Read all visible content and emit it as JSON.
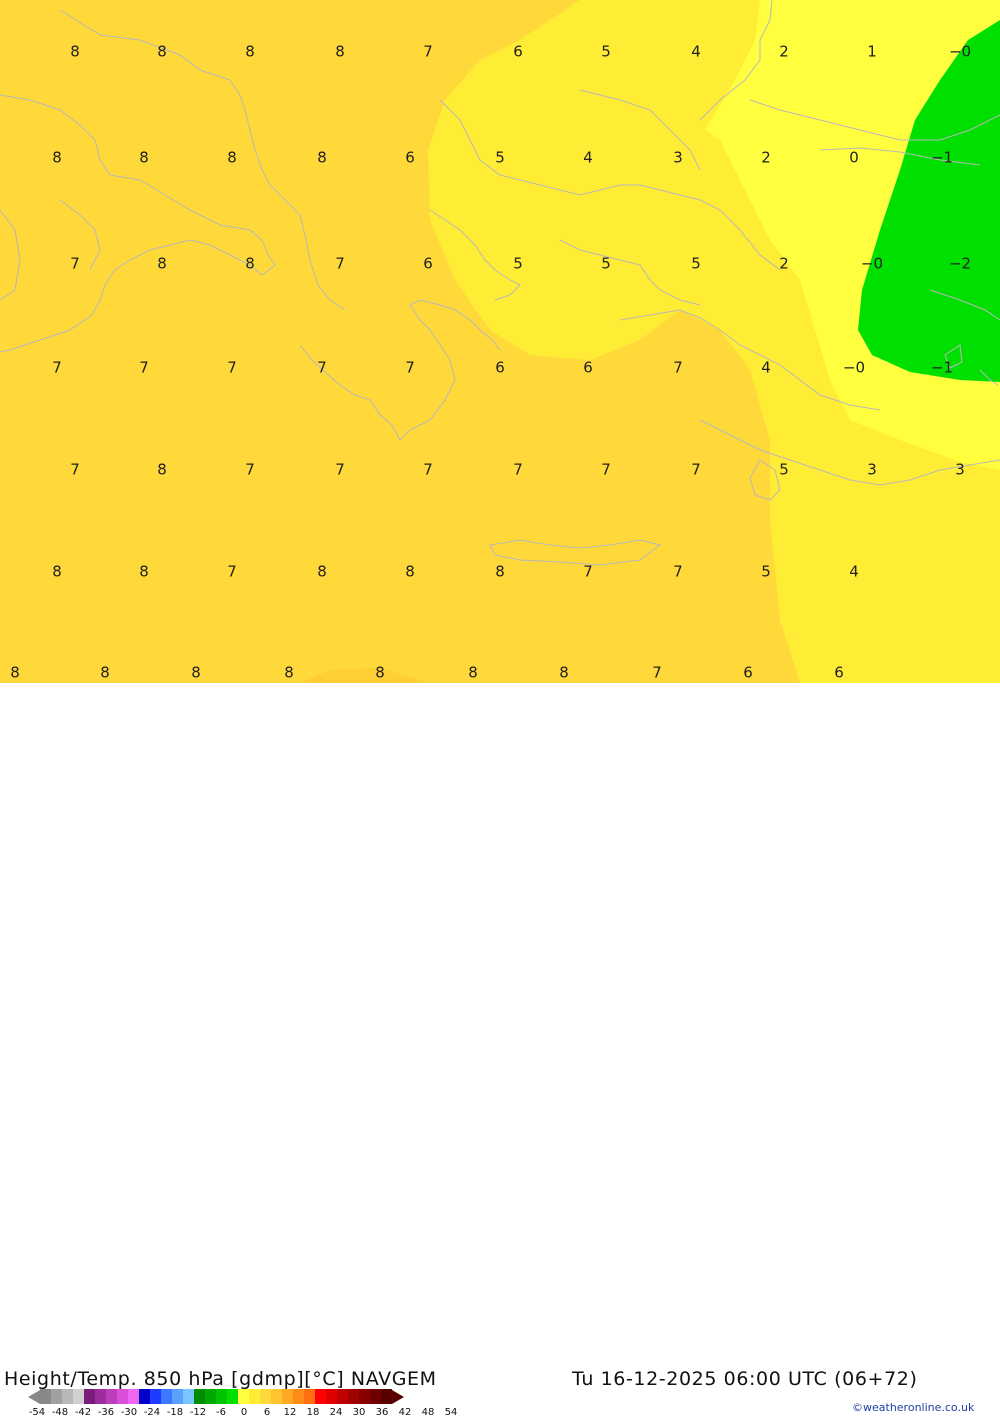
{
  "map": {
    "colors": {
      "base": "#ffd93a",
      "light": "#ffec35",
      "pale": "#ffff40",
      "green": "#00e000",
      "orange": "#ffc42e",
      "coast": "#b9b9b9"
    },
    "values": [
      "8",
      "8",
      "8",
      "8",
      "7",
      "6",
      "5",
      "4",
      "2",
      "1",
      "−0",
      "8",
      "8",
      "8",
      "8",
      "6",
      "5",
      "4",
      "3",
      "2",
      "0",
      "−1",
      "7",
      "8",
      "8",
      "7",
      "6",
      "5",
      "5",
      "5",
      "2",
      "−0",
      "−2",
      "7",
      "7",
      "7",
      "7",
      "7",
      "6",
      "6",
      "7",
      "4",
      "−0",
      "−1",
      "7",
      "8",
      "7",
      "7",
      "7",
      "7",
      "7",
      "7",
      "5",
      "3",
      "3",
      "8",
      "8",
      "7",
      "8",
      "8",
      "8",
      "7",
      "7",
      "5",
      "4",
      "8",
      "8",
      "8",
      "8",
      "8",
      "8",
      "8",
      "7",
      "6",
      "6"
    ]
  },
  "footer": {
    "title": "Height/Temp. 850 hPa [gdmp][°C] NAVGEM",
    "datetime": "Tu 16-12-2025 06:00 UTC (06+72)",
    "credit": "©weatheronline.co.uk",
    "scale_colors": [
      "#888888",
      "#a0a0a0",
      "#b8b8b8",
      "#d0d0d0",
      "#7b1e7b",
      "#9b2e9b",
      "#bb3ebb",
      "#db4edb",
      "#f066f0",
      "#0000c8",
      "#1e3cff",
      "#3c78ff",
      "#5aa0ff",
      "#78c8ff",
      "#008c00",
      "#00a800",
      "#00c400",
      "#00e000",
      "#ffff40",
      "#ffec35",
      "#ffd93a",
      "#ffc42e",
      "#ffaa22",
      "#ff8c18",
      "#ff6e10",
      "#ff0000",
      "#e00000",
      "#c00000",
      "#a00000",
      "#880000",
      "#700000",
      "#580000"
    ],
    "scale_labels": [
      "-54",
      "-48",
      "-42",
      "-36",
      "-30",
      "-24",
      "-18",
      "-12",
      "-6",
      "0",
      "6",
      "12",
      "18",
      "24",
      "30",
      "36",
      "42",
      "48",
      "54"
    ]
  }
}
